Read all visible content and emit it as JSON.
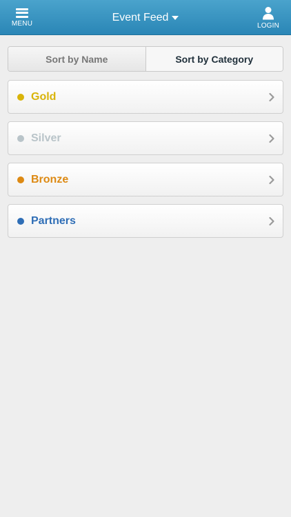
{
  "header": {
    "menu_label": "MENU",
    "title": "Event Feed",
    "login_label": "LOGIN"
  },
  "sort": {
    "by_name": "Sort by Name",
    "by_category": "Sort by Category",
    "selected": "Sort by Category"
  },
  "categories": [
    {
      "label": "Gold",
      "color": "#d9b40a"
    },
    {
      "label": "Silver",
      "color": "#b9c4c9"
    },
    {
      "label": "Bronze",
      "color": "#dd8a14"
    },
    {
      "label": "Partners",
      "color": "#2f6eb6"
    }
  ],
  "icons": {
    "menu": "hamburger-icon",
    "title_dropdown": "caret-down-icon",
    "login": "user-icon",
    "row_action": "chevron-right-icon"
  }
}
